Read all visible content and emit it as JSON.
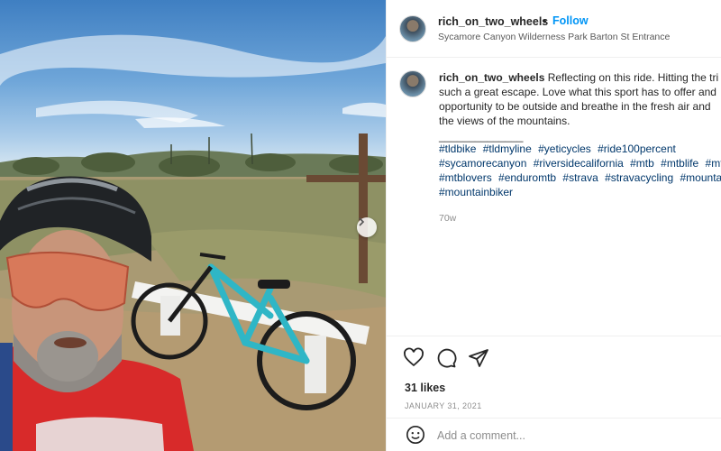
{
  "post": {
    "username": "rich_on_two_wheels",
    "follow_label": "Follow",
    "separator": "•",
    "location": "Sycamore Canyon Wilderness Park Barton St Entrance"
  },
  "caption": {
    "username": "rich_on_two_wheels",
    "lines": [
      "Reflecting on this ride. Hitting the tri",
      "such a great escape. Love what this sport has to offer and",
      "opportunity to be outside and breathe in the fresh air and",
      "the views of the mountains."
    ],
    "divider": "______________",
    "hashtag_lines": [
      [
        "#tldbike",
        "#tldmyline",
        "#yeticycles",
        "#ride100percent"
      ],
      [
        "#sycamorecanyon",
        "#riversidecalifornia",
        "#mtb",
        "#mtblife",
        "#mt"
      ],
      [
        "#mtblovers",
        "#enduromtb",
        "#strava",
        "#stravacycling",
        "#mounta"
      ],
      [
        "#mountainbiker"
      ]
    ],
    "time_ago": "70w"
  },
  "engagement": {
    "likes": "31 likes",
    "date": "JANUARY 31, 2021"
  },
  "comment": {
    "placeholder": "Add a comment..."
  },
  "icons": {
    "like": "heart-icon",
    "comment": "comment-icon",
    "share": "share-icon",
    "emoji": "emoji-icon",
    "next": "chevron-right-icon"
  },
  "colors": {
    "follow": "#0095f6",
    "hashtag": "#00376b",
    "meta": "#8e8e8e",
    "bike": "#2fb6c6"
  }
}
